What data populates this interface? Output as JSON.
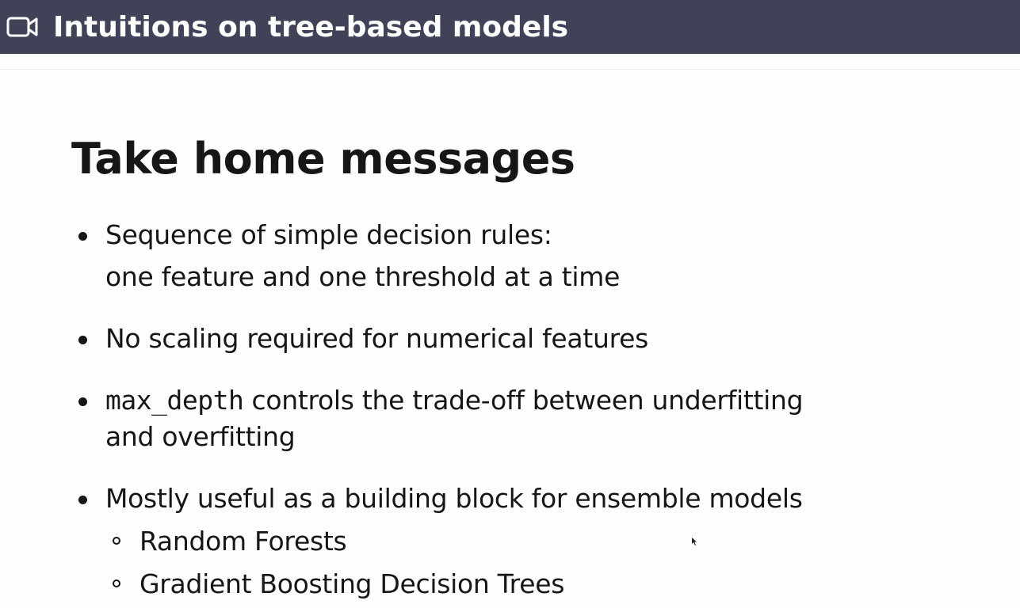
{
  "header": {
    "icon": "video-icon",
    "title": "Intuitions on tree-based models",
    "background_color": "#404357"
  },
  "slide": {
    "title": "Take home messages",
    "bullets": [
      {
        "line1": "Sequence of simple decision rules:",
        "line2": "one feature and one threshold at a time"
      },
      {
        "line1": "No scaling required for numerical features"
      },
      {
        "code": "max_depth",
        "line1_rest": " controls the trade-off between underfitting",
        "line2": "and overfitting"
      },
      {
        "line1": "Mostly useful as a building block for ensemble models",
        "sub": [
          "Random Forests",
          "Gradient Boosting Decision Trees"
        ]
      }
    ]
  }
}
